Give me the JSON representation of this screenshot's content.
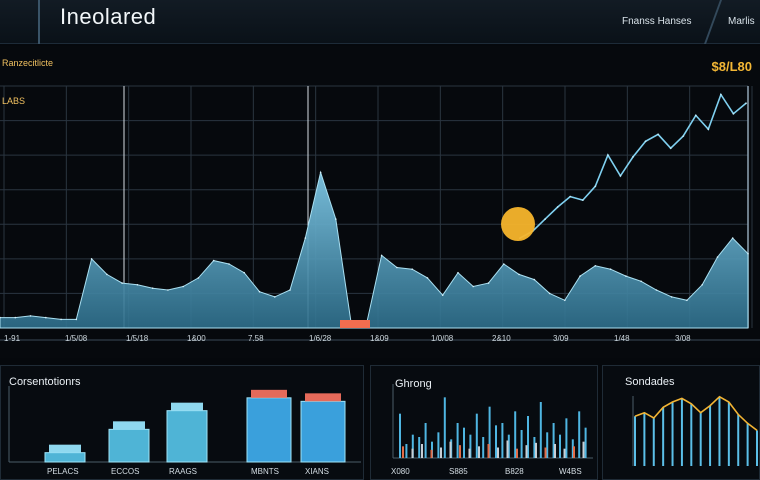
{
  "header": {
    "title": "Ineolared",
    "button_1": "Fnanss Hanses",
    "button_2": "Marlis"
  },
  "main_chart": {
    "label_top": "Ranzecitlicte",
    "label_axis": "LABS",
    "price": "$8/L80",
    "x_ticks": [
      "1-91",
      "1/5/08",
      "1/5/18",
      "1&00",
      "7.58",
      "1/6/28",
      "1&09",
      "1/0/08",
      "2&10",
      "3/09",
      "1/48",
      "3/08"
    ]
  },
  "chart_data": [
    {
      "type": "area",
      "title": "",
      "series": [
        {
          "values": [
            6,
            6,
            7,
            6,
            5,
            5,
            40,
            31,
            26,
            25,
            23,
            22,
            24,
            29,
            39,
            37,
            32,
            21,
            18,
            22,
            52,
            90,
            63,
            3,
            2,
            42,
            35,
            34,
            29,
            19,
            32,
            24,
            26,
            37,
            31,
            28,
            20,
            16,
            30,
            36,
            34,
            30,
            27,
            22,
            18,
            16,
            25,
            41,
            52,
            43
          ]
        }
      ],
      "line_values": [
        52,
        56,
        63,
        70,
        76,
        74,
        82,
        100,
        88,
        99,
        108,
        112,
        104,
        111,
        123,
        115,
        135,
        124,
        130
      ]
    },
    {
      "type": "bar",
      "title": "Corsentotionrs",
      "categories": [
        "PELACS",
        "ECCOS",
        "RAAGS",
        "MBNTS",
        "XIANS"
      ],
      "values": [
        8,
        28,
        44,
        55,
        52
      ]
    },
    {
      "type": "bar",
      "title": "Ghrong",
      "categories": [
        "X080",
        "S885",
        "B828",
        "W4BS"
      ],
      "series": [
        {
          "values": [
            38,
            12,
            20,
            18,
            30,
            14,
            22,
            52,
            16,
            30,
            26,
            20,
            38,
            18,
            44,
            28,
            30,
            20,
            40,
            24,
            36,
            18,
            48,
            22,
            30,
            20,
            34,
            16,
            40,
            26
          ]
        },
        {
          "values": [
            10,
            8,
            12,
            7,
            9,
            14,
            11,
            8,
            10,
            12,
            9,
            15,
            8,
            11,
            13,
            9,
            12,
            8,
            10,
            14
          ]
        }
      ]
    },
    {
      "type": "line",
      "title": "Sondades",
      "values": [
        28,
        30,
        27,
        33,
        36,
        38,
        35,
        30,
        34,
        39,
        36,
        29,
        24,
        20
      ]
    }
  ],
  "panel1": {
    "title": "Corsentotionrs",
    "x_labels": [
      "PELACS",
      "ECCOS",
      "RAAGS",
      "MBNTS",
      "XIANS"
    ]
  },
  "panel2": {
    "title": "Ghrong",
    "x_labels": [
      "X080",
      "S885",
      "B828",
      "W4BS"
    ]
  },
  "panel3": {
    "title": "Sondades"
  }
}
